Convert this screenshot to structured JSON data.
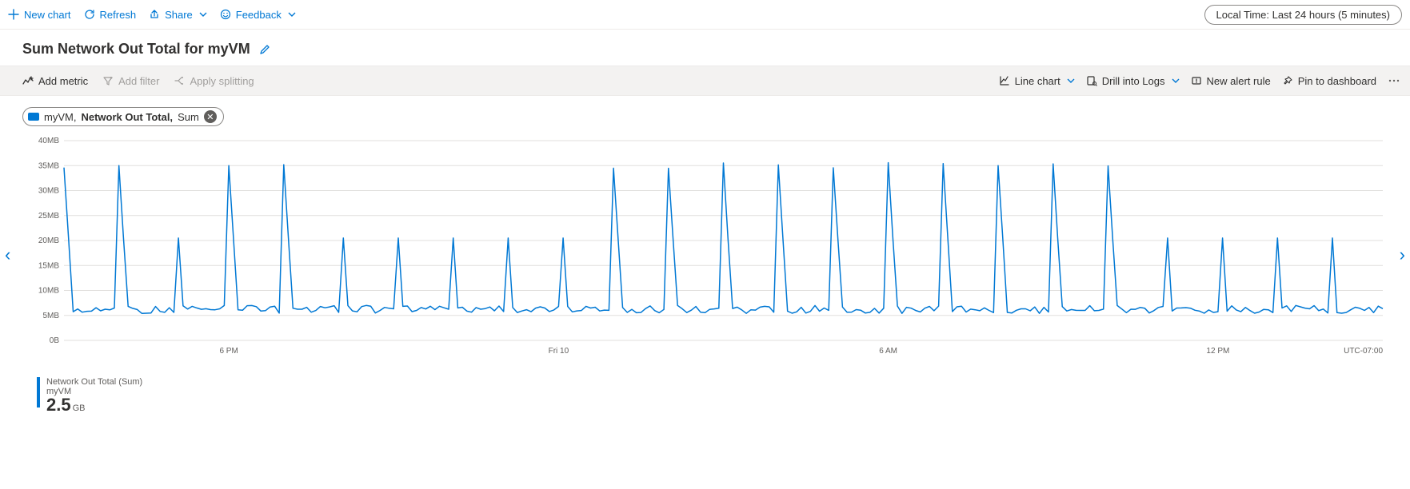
{
  "topbar": {
    "new_chart": "New chart",
    "refresh": "Refresh",
    "share": "Share",
    "feedback": "Feedback",
    "time_pill": "Local Time: Last 24 hours (5 minutes)"
  },
  "title": "Sum Network Out Total for myVM",
  "cmdbar": {
    "add_metric": "Add metric",
    "add_filter": "Add filter",
    "apply_splitting": "Apply splitting",
    "chart_type": "Line chart",
    "drill_logs": "Drill into Logs",
    "new_alert": "New alert rule",
    "pin": "Pin to dashboard"
  },
  "metric_pill": {
    "resource": "myVM,",
    "metric": "Network Out Total,",
    "agg": "Sum"
  },
  "legend": {
    "line1": "Network Out Total (Sum)",
    "line2": "myVM",
    "value": "2.5",
    "unit": "GB"
  },
  "tz": "UTC-07:00",
  "chart_data": {
    "type": "line",
    "title": "Sum Network Out Total for myVM",
    "xlabel": "",
    "ylabel": "",
    "y_unit": "MB",
    "ylim": [
      0,
      40
    ],
    "y_ticks": [
      0,
      5,
      10,
      15,
      20,
      25,
      30,
      35,
      40
    ],
    "y_tick_labels": [
      "0B",
      "5MB",
      "10MB",
      "15MB",
      "20MB",
      "25MB",
      "30MB",
      "35MB",
      "40MB"
    ],
    "x_range_hours": 24,
    "x_ticks": [
      {
        "h": 3,
        "label": "6 PM"
      },
      {
        "h": 9,
        "label": "Fri 10"
      },
      {
        "h": 15,
        "label": "6 AM"
      },
      {
        "h": 21,
        "label": "12 PM"
      }
    ],
    "series": [
      {
        "name": "Network Out Total (Sum)",
        "resource": "myVM",
        "aggregation": "Sum"
      }
    ],
    "spike_period_hours": 1,
    "spike_value_mb": 35,
    "baseline_value_mb": 6,
    "time_granularity_minutes": 5,
    "total_over_window": "2.5 GB"
  }
}
